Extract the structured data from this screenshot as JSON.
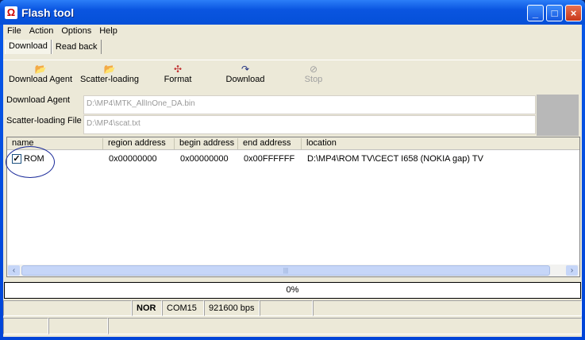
{
  "window": {
    "title": "Flash tool",
    "buttons": {
      "minimize": "_",
      "maximize": "□",
      "close": "×"
    }
  },
  "menu": [
    "File",
    "Action",
    "Options",
    "Help"
  ],
  "tabs": [
    "Download",
    "Read back"
  ],
  "toolbar": [
    {
      "label": "Download Agent",
      "icon": "folder-open-icon",
      "enabled": true
    },
    {
      "label": "Scatter-loading",
      "icon": "folder-open-icon",
      "enabled": true
    },
    {
      "label": "Format",
      "icon": "format-icon",
      "enabled": true
    },
    {
      "label": "Download",
      "icon": "download-arrow-icon",
      "enabled": true
    },
    {
      "label": "Stop",
      "icon": "stop-icon",
      "enabled": false
    }
  ],
  "fields": {
    "download_agent": {
      "label": "Download Agent",
      "value": "D:\\MP4\\MTK_AllInOne_DA.bin"
    },
    "scatter": {
      "label": "Scatter-loading File",
      "value": "D:\\MP4\\scat.txt"
    }
  },
  "list": {
    "columns": [
      "name",
      "region address",
      "begin address",
      "end address",
      "location"
    ],
    "rows": [
      {
        "checked": true,
        "name": "ROM",
        "region": "0x00000000",
        "begin": "0x00000000",
        "end": "0x00FFFFFF",
        "location": "D:\\MP4\\ROM TV\\CECT I658 (NOKIA gap) TV"
      }
    ]
  },
  "progress": {
    "text": "0%",
    "value": 0
  },
  "status": {
    "type": "NOR",
    "port": "COM15",
    "baud": "921600 bps"
  }
}
